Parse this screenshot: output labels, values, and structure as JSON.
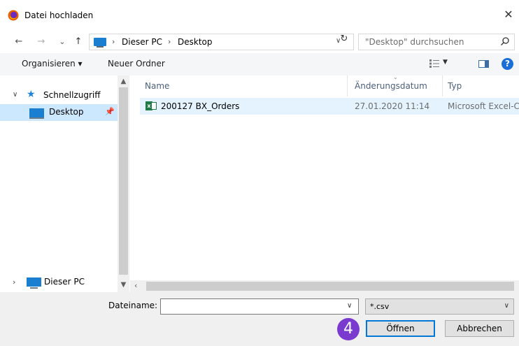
{
  "window": {
    "title": "Datei hochladen",
    "close_glyph": "✕"
  },
  "nav": {
    "back_glyph": "←",
    "forward_glyph": "→",
    "recent_glyph": "⌄",
    "up_glyph": "↑",
    "breadcrumb": [
      "Dieser PC",
      "Desktop"
    ],
    "breadcrumb_sep": "›",
    "refresh_glyph": "↻",
    "search_placeholder": "\"Desktop\" durchsuchen"
  },
  "toolbar": {
    "organize_label": "Organisieren ▾",
    "new_folder_label": "Neuer Ordner",
    "help_glyph": "?"
  },
  "sidebar": {
    "items": [
      {
        "label": "Schnellzugriff",
        "icon": "star-icon",
        "expanded": true
      },
      {
        "label": "Desktop",
        "icon": "desktop-icon",
        "pinned": true,
        "selected": true
      },
      {
        "label": "Dieser PC",
        "icon": "pc-icon",
        "expanded": false
      }
    ]
  },
  "files": {
    "columns": [
      "Name",
      "Änderungsdatum",
      "Typ"
    ],
    "rows": [
      {
        "name": "200127 BX_Orders",
        "date": "27.01.2020 11:14",
        "type": "Microsoft Excel-C",
        "icon": "excel-csv-icon"
      }
    ]
  },
  "bottom": {
    "filename_label": "Dateiname:",
    "filename_value": "",
    "filetype_value": "*.csv",
    "open_label": "Öffnen",
    "cancel_label": "Abbrechen",
    "step_badge": "4"
  },
  "colors": {
    "accent": "#0078d7",
    "selection": "#cce8ff",
    "hover_row": "#e5f3ff",
    "badge": "#7a3ad0",
    "excel_green": "#1f7b45"
  }
}
